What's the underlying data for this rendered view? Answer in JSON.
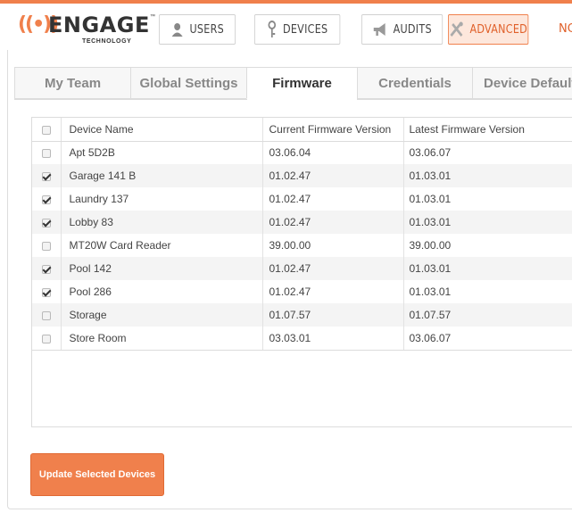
{
  "brand": {
    "name": "ENGAGE",
    "subtitle": "TECHNOLOGY",
    "trademark": "™",
    "accent": "#f0804c"
  },
  "nav": {
    "items": [
      {
        "label": "USERS",
        "icon": "user-icon"
      },
      {
        "label": "DEVICES",
        "icon": "key-icon"
      },
      {
        "label": "AUDITS",
        "icon": "megaphone-icon"
      },
      {
        "label": "ADVANCED",
        "icon": "tools-icon",
        "active": true
      }
    ],
    "clipped_label": "NO"
  },
  "tabs": [
    {
      "label": "My Team"
    },
    {
      "label": "Global Settings"
    },
    {
      "label": "Firmware",
      "active": true
    },
    {
      "label": "Credentials"
    },
    {
      "label": "Device Defaults"
    }
  ],
  "table": {
    "columns": [
      "Device Name",
      "Current Firmware Version",
      "Latest Firmware Version"
    ],
    "rows": [
      {
        "name": "Apt 5D2B",
        "current": "03.06.04",
        "latest": "03.06.07",
        "checked": false
      },
      {
        "name": "Garage 141 B",
        "current": "01.02.47",
        "latest": "01.03.01",
        "checked": true
      },
      {
        "name": "Laundry 137",
        "current": "01.02.47",
        "latest": "01.03.01",
        "checked": true
      },
      {
        "name": "Lobby 83",
        "current": "01.02.47",
        "latest": "01.03.01",
        "checked": true
      },
      {
        "name": "MT20W Card Reader",
        "current": "39.00.00",
        "latest": "39.00.00",
        "checked": false
      },
      {
        "name": "Pool 142",
        "current": "01.02.47",
        "latest": "01.03.01",
        "checked": true
      },
      {
        "name": "Pool 286",
        "current": "01.02.47",
        "latest": "01.03.01",
        "checked": true
      },
      {
        "name": "Storage",
        "current": "01.07.57",
        "latest": "01.07.57",
        "checked": false
      },
      {
        "name": "Store Room",
        "current": "03.03.01",
        "latest": "03.06.07",
        "checked": false
      }
    ]
  },
  "actions": {
    "update_label": "Update Selected Devices"
  }
}
